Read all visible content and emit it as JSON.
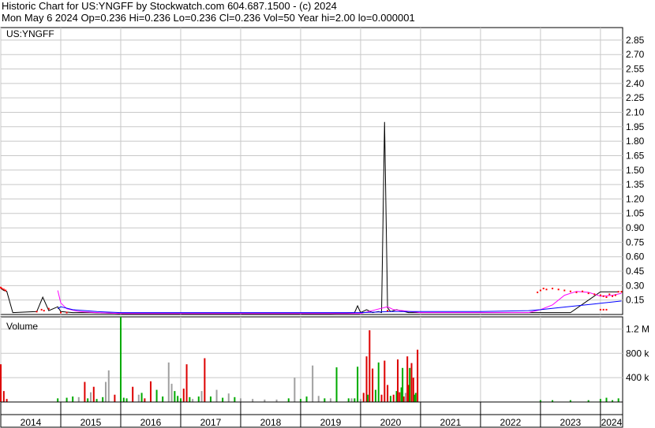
{
  "header": {
    "line1": "Historic Chart for US:YNGFF by Stockwatch.com 604.687.1500 - (c) 2024",
    "line2": "Mon May  6 2024   Op=0.236  Hi=0.236  Lo=0.236  Cl=0.236  Vol=50  Year hi=2.00  lo=0.000001"
  },
  "colors": {
    "background": "#ffffff",
    "grid": "#c8c8c8",
    "price": "#000000",
    "ma_short": "#ff00ff",
    "ma_long": "#0000ff",
    "marker": "#ff0000",
    "vol_up": "#00aa00",
    "vol_down": "#dd0000",
    "vol_flat": "#a0a0a0"
  },
  "chart_data": [
    {
      "type": "line",
      "panel": "price",
      "title": "US:YNGFF",
      "x_unit": "year",
      "xlim": [
        2014.0,
        2024.37
      ],
      "ylim": [
        0.0,
        2.98
      ],
      "y_ticks": [
        0.15,
        0.3,
        0.45,
        0.6,
        0.75,
        0.9,
        1.05,
        1.2,
        1.35,
        1.5,
        1.65,
        1.8,
        1.95,
        2.1,
        2.25,
        2.4,
        2.55,
        2.7,
        2.85
      ],
      "y_tick_labels": [
        "0.15",
        "0.30",
        "0.45",
        "0.60",
        "0.75",
        "0.90",
        "1.05",
        "1.20",
        "1.35",
        "1.50",
        "1.65",
        "1.80",
        "1.95",
        "2.10",
        "2.25",
        "2.40",
        "2.55",
        "2.70",
        "2.85"
      ],
      "x_tick_labels": [
        "2014",
        "2015",
        "2016",
        "2017",
        "2018",
        "2019",
        "2020",
        "2021",
        "2022",
        "2023",
        "2024"
      ],
      "x_tick_positions": [
        2014.0,
        2015.0,
        2016.0,
        2017.0,
        2018.0,
        2019.0,
        2020.0,
        2021.0,
        2022.0,
        2023.0,
        2024.0
      ],
      "grid": true,
      "series": [
        {
          "role": "price",
          "x": [
            2014.0,
            2014.05,
            2014.1,
            2014.2,
            2014.6,
            2014.7,
            2014.8,
            2014.95,
            2015.0,
            2015.2,
            2015.5,
            2016.0,
            2016.5,
            2017.0,
            2017.5,
            2018.0,
            2018.5,
            2019.0,
            2019.5,
            2019.9,
            2019.95,
            2020.0,
            2020.1,
            2020.2,
            2020.3,
            2020.35,
            2020.4,
            2020.45,
            2020.5,
            2020.6,
            2020.8,
            2021.0,
            2022.0,
            2023.0,
            2023.5,
            2024.0,
            2024.3
          ],
          "y": [
            0.27,
            0.25,
            0.24,
            0.02,
            0.03,
            0.18,
            0.04,
            0.08,
            0.03,
            0.02,
            0.02,
            0.01,
            0.01,
            0.01,
            0.01,
            0.01,
            0.01,
            0.01,
            0.01,
            0.02,
            0.09,
            0.02,
            0.05,
            0.02,
            0.03,
            0.02,
            2.0,
            0.07,
            0.03,
            0.05,
            0.02,
            0.02,
            0.02,
            0.02,
            0.02,
            0.236,
            0.236
          ]
        },
        {
          "role": "moving-average-short",
          "x": [
            2014.95,
            2015.0,
            2015.1,
            2015.3,
            2015.6,
            2016.0,
            2017.0,
            2018.0,
            2019.0,
            2020.0,
            2020.45,
            2020.55,
            2021.0,
            2022.0,
            2022.8,
            2023.0,
            2023.2,
            2023.4,
            2023.6,
            2023.8,
            2024.0,
            2024.2,
            2024.35
          ],
          "y": [
            0.25,
            0.12,
            0.06,
            0.03,
            0.02,
            0.01,
            0.01,
            0.01,
            0.01,
            0.01,
            0.08,
            0.05,
            0.02,
            0.02,
            0.02,
            0.05,
            0.1,
            0.2,
            0.24,
            0.23,
            0.19,
            0.2,
            0.22
          ]
        },
        {
          "role": "moving-average-long",
          "x": [
            2014.95,
            2015.0,
            2015.2,
            2015.6,
            2016.0,
            2017.0,
            2018.0,
            2019.0,
            2020.0,
            2020.5,
            2021.0,
            2022.0,
            2022.8,
            2023.0,
            2023.3,
            2023.6,
            2023.9,
            2024.2,
            2024.35
          ],
          "y": [
            0.06,
            0.08,
            0.05,
            0.03,
            0.02,
            0.02,
            0.02,
            0.02,
            0.02,
            0.03,
            0.03,
            0.03,
            0.04,
            0.05,
            0.07,
            0.09,
            0.11,
            0.13,
            0.14
          ]
        },
        {
          "role": "markers",
          "x": [
            2014.0,
            2014.02,
            2014.05,
            2014.08,
            2014.6,
            2014.68,
            2014.72,
            2014.8,
            2015.0,
            2015.1,
            2020.45,
            2022.95,
            2023.0,
            2023.05,
            2023.1,
            2023.2,
            2023.3,
            2023.4,
            2023.5,
            2023.6,
            2023.7,
            2023.8,
            2023.9,
            2024.0,
            2024.05,
            2024.1,
            2024.15,
            2024.2,
            2024.25,
            2024.3,
            2024.35,
            2024.0,
            2024.05,
            2024.1
          ],
          "y": [
            0.28,
            0.27,
            0.26,
            0.25,
            0.03,
            0.05,
            0.04,
            0.06,
            0.02,
            0.02,
            0.04,
            0.23,
            0.25,
            0.27,
            0.26,
            0.27,
            0.26,
            0.25,
            0.24,
            0.23,
            0.24,
            0.22,
            0.21,
            0.2,
            0.19,
            0.18,
            0.21,
            0.19,
            0.2,
            0.236,
            0.236,
            0.05,
            0.05,
            0.05
          ]
        }
      ]
    },
    {
      "type": "bar",
      "panel": "volume",
      "title": "Volume",
      "x_unit": "year",
      "xlim": [
        2014.0,
        2024.37
      ],
      "ylim": [
        0,
        1400000
      ],
      "y_ticks": [
        400000,
        800000,
        1200000
      ],
      "y_tick_labels": [
        "400 k",
        "800 k",
        "1.2 M"
      ],
      "grid": true,
      "x": [
        2014.0,
        2014.05,
        2014.1,
        2014.95,
        2015.1,
        2015.2,
        2015.3,
        2015.4,
        2015.45,
        2015.5,
        2015.55,
        2015.6,
        2015.7,
        2015.75,
        2015.8,
        2015.9,
        2016.0,
        2016.05,
        2016.1,
        2016.2,
        2016.3,
        2016.35,
        2016.4,
        2016.5,
        2016.6,
        2016.7,
        2016.8,
        2016.85,
        2016.9,
        2016.95,
        2017.0,
        2017.05,
        2017.1,
        2017.15,
        2017.2,
        2017.3,
        2017.35,
        2017.4,
        2017.5,
        2017.6,
        2017.7,
        2017.8,
        2017.9,
        2018.0,
        2018.2,
        2018.4,
        2018.6,
        2018.8,
        2018.9,
        2019.0,
        2019.1,
        2019.2,
        2019.3,
        2019.4,
        2019.5,
        2019.6,
        2019.8,
        2019.85,
        2019.9,
        2019.95,
        2020.0,
        2020.05,
        2020.1,
        2020.12,
        2020.15,
        2020.2,
        2020.25,
        2020.3,
        2020.35,
        2020.4,
        2020.45,
        2020.5,
        2020.55,
        2020.6,
        2020.62,
        2020.65,
        2020.68,
        2020.7,
        2020.72,
        2020.75,
        2020.78,
        2020.8,
        2020.82,
        2020.85,
        2020.88,
        2020.9,
        2020.92,
        2020.95,
        2023.0,
        2023.2,
        2023.5,
        2023.8,
        2024.0,
        2024.1,
        2024.2,
        2024.3
      ],
      "values": [
        620000,
        180000,
        50000,
        60000,
        70000,
        90000,
        80000,
        330000,
        60000,
        160000,
        250000,
        50000,
        80000,
        330000,
        520000,
        120000,
        1400000,
        70000,
        60000,
        250000,
        120000,
        150000,
        60000,
        340000,
        200000,
        90000,
        650000,
        300000,
        180000,
        100000,
        60000,
        220000,
        620000,
        80000,
        50000,
        90000,
        180000,
        720000,
        90000,
        200000,
        70000,
        140000,
        80000,
        60000,
        50000,
        40000,
        40000,
        60000,
        400000,
        50000,
        90000,
        600000,
        100000,
        60000,
        60000,
        570000,
        60000,
        60000,
        60000,
        580000,
        50000,
        150000,
        750000,
        120000,
        1180000,
        550000,
        200000,
        650000,
        120000,
        680000,
        280000,
        100000,
        120000,
        180000,
        700000,
        160000,
        240000,
        560000,
        90000,
        150000,
        750000,
        280000,
        560000,
        640000,
        400000,
        120000,
        150000,
        860000,
        30000,
        30000,
        30000,
        30000,
        50000,
        70000,
        30000,
        60000
      ],
      "colors": [
        "down",
        "down",
        "down",
        "up",
        "up",
        "up",
        "flat",
        "down",
        "up",
        "flat",
        "down",
        "up",
        "up",
        "flat",
        "flat",
        "down",
        "up",
        "up",
        "up",
        "down",
        "flat",
        "up",
        "down",
        "down",
        "up",
        "up",
        "flat",
        "flat",
        "up",
        "up",
        "up",
        "down",
        "down",
        "up",
        "flat",
        "up",
        "flat",
        "down",
        "up",
        "flat",
        "up",
        "flat",
        "up",
        "flat",
        "flat",
        "flat",
        "flat",
        "up",
        "flat",
        "up",
        "up",
        "flat",
        "flat",
        "up",
        "flat",
        "up",
        "up",
        "flat",
        "up",
        "up",
        "flat",
        "down",
        "down",
        "up",
        "down",
        "down",
        "up",
        "up",
        "down",
        "down",
        "down",
        "up",
        "down",
        "up",
        "down",
        "down",
        "up",
        "up",
        "down",
        "flat",
        "down",
        "down",
        "up",
        "down",
        "down",
        "up",
        "up",
        "down",
        "up",
        "up",
        "up",
        "up",
        "up",
        "up",
        "up",
        "up"
      ]
    }
  ]
}
